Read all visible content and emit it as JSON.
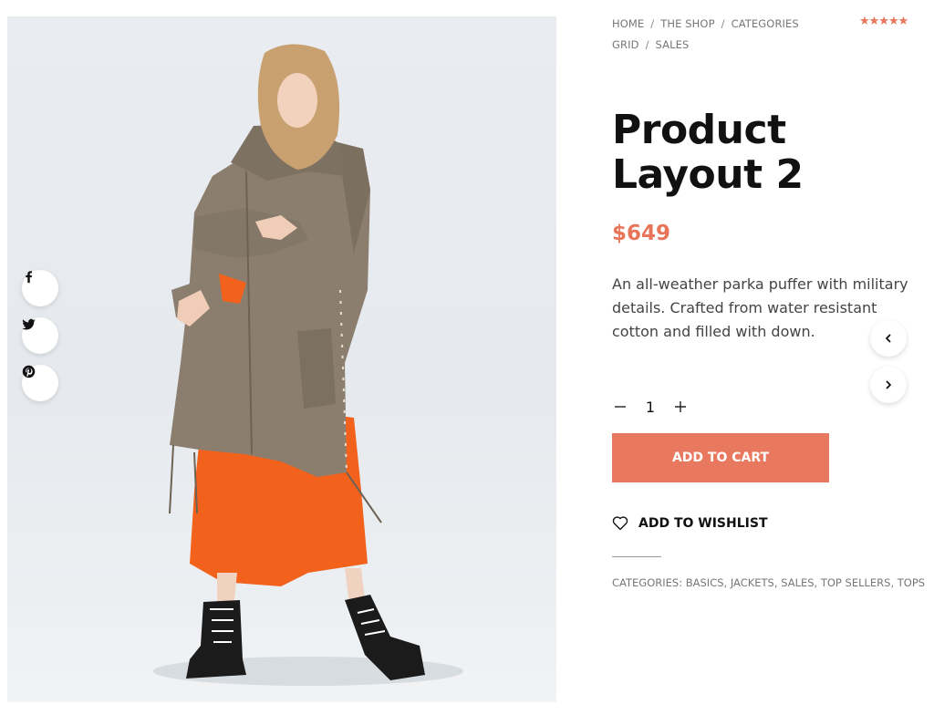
{
  "breadcrumb": {
    "items": [
      "Home",
      "The Shop",
      "Categories",
      "Grid",
      "Sales"
    ],
    "separator": "/"
  },
  "rating": {
    "stars": 5,
    "max": 5,
    "glyphs": "★★★★★"
  },
  "product": {
    "title": "Product Layout 2",
    "price": "$649",
    "description": "An all-weather parka puffer with military details. Crafted from water resistant cotton and filled with down."
  },
  "quantity": {
    "value": "1"
  },
  "actions": {
    "add_to_cart": "ADD TO CART",
    "add_to_wishlist": "ADD TO WISHLIST"
  },
  "meta": {
    "categories_label": "Categories:",
    "categories": [
      "Basics",
      "Jackets",
      "Sales",
      "Top Sellers",
      "Tops"
    ]
  },
  "share": {
    "icons": [
      "facebook-icon",
      "twitter-icon",
      "pinterest-icon"
    ]
  },
  "colors": {
    "accent": "#e8795e",
    "text": "#111111",
    "muted": "#777777"
  }
}
